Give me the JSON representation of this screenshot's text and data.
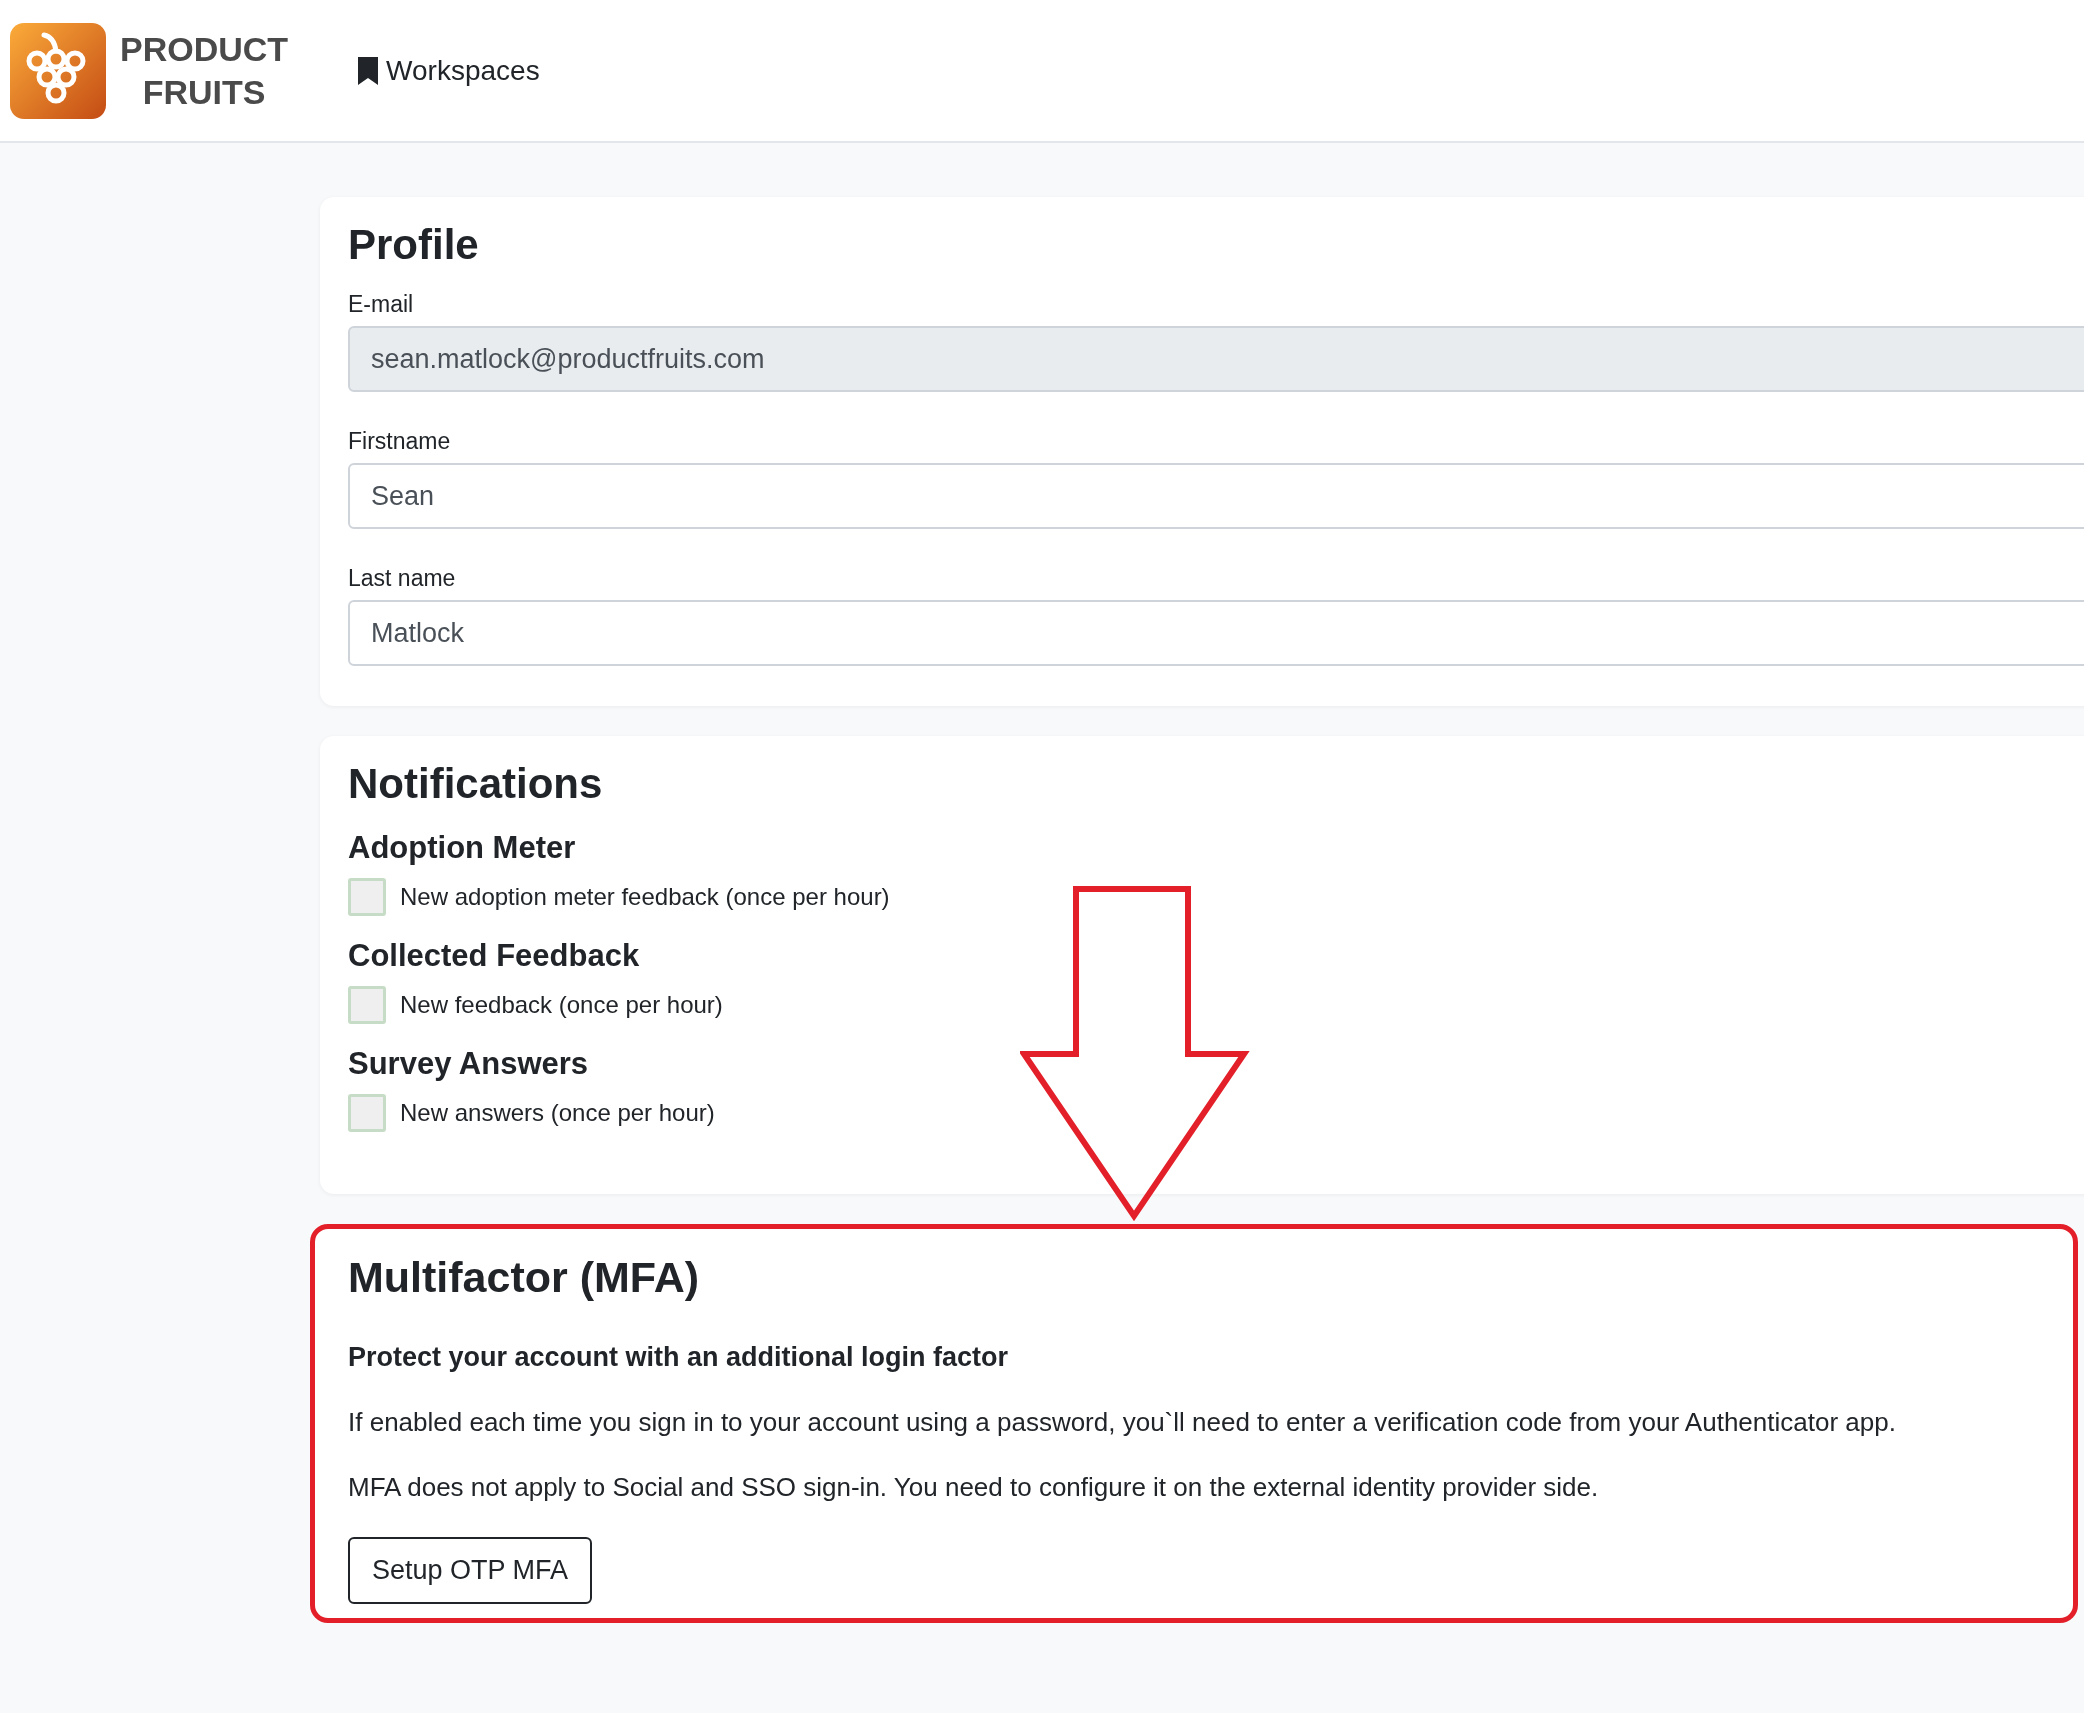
{
  "header": {
    "logo_lines": [
      "PRODUCT",
      "FRUITS"
    ],
    "nav": [
      {
        "label": "Workspaces"
      }
    ]
  },
  "profile": {
    "title": "Profile",
    "fields": [
      {
        "label": "E-mail",
        "value": "sean.matlock@productfruits.com",
        "disabled": true
      },
      {
        "label": "Firstname",
        "value": "Sean",
        "disabled": false
      },
      {
        "label": "Last name",
        "value": "Matlock",
        "disabled": false
      }
    ]
  },
  "notifications": {
    "title": "Notifications",
    "groups": [
      {
        "heading": "Adoption Meter",
        "option": {
          "label": "New adoption meter feedback (once per hour)",
          "checked": false
        }
      },
      {
        "heading": "Collected Feedback",
        "option": {
          "label": "New feedback (once per hour)",
          "checked": false
        }
      },
      {
        "heading": "Survey Answers",
        "option": {
          "label": "New answers (once per hour)",
          "checked": false
        }
      }
    ]
  },
  "mfa": {
    "title": "Multifactor (MFA)",
    "subtitle": "Protect your account with an additional login factor",
    "paragraphs": [
      "If enabled each time you sign in to your account using a password, you`ll need to enter a verification code from your Authenticator app.",
      "MFA does not apply to Social and SSO sign-in. You need to configure it on the external identity provider side."
    ],
    "button": "Setup OTP MFA"
  }
}
